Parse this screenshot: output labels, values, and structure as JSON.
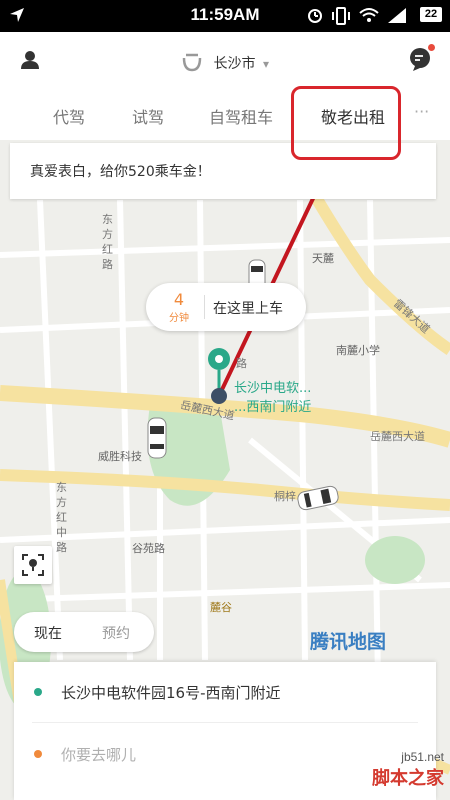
{
  "status_bar": {
    "time": "11:59AM",
    "battery": "22"
  },
  "header": {
    "city": "长沙市",
    "city_arrow": "▾"
  },
  "tabs": [
    {
      "label": "代驾",
      "active": false
    },
    {
      "label": "试驾",
      "active": false
    },
    {
      "label": "自驾租车",
      "active": false
    },
    {
      "label": "敬老出租",
      "active": true
    }
  ],
  "tabs_more": "···",
  "banner": {
    "text": "真爱表白，给你520乘车金！"
  },
  "pickup": {
    "minutes": "4",
    "unit": "分钟",
    "label": "在这里上车"
  },
  "map": {
    "poi_line1": "长沙中电软...",
    "poi_line2": "...西南门附近",
    "labels": {
      "dongfanghonglu_v": "东方红路",
      "tianlu": "天麓",
      "leifengdadao": "雷锋大道",
      "nanlu_school": "南麓小学",
      "yuelu_west_left": "岳麓西大道",
      "yuelu_west_right": "岳麓西大道",
      "weisheng": "威胜科技",
      "tongzhao": "桐梓",
      "dongfanghong_zhonglu": "东方红中路",
      "guyuan_road": "谷苑路",
      "lugu": "麓谷",
      "lu": "路",
      "tencent_map": "腾讯地图"
    },
    "colors": {
      "accent_green": "#2aa889",
      "road_yellow": "#f6e2a0",
      "park_green": "#c8e6c4"
    }
  },
  "time_toggle": {
    "now": "现在",
    "reserve": "预约"
  },
  "address_card": {
    "from": "长沙中电软件园16号-西南门附近",
    "to_placeholder": "你要去哪儿",
    "from_color": "#2aa889",
    "to_color": "#f08a3c"
  },
  "watermark": {
    "site": "jb51.net",
    "name": "脚本之家"
  },
  "icons": [
    "navigation-icon",
    "alarm-icon",
    "vibrate-icon",
    "wifi-icon",
    "signal-icon",
    "user-icon",
    "didi-logo-icon",
    "message-icon",
    "location-pin-icon",
    "locate-icon",
    "car-icon"
  ]
}
